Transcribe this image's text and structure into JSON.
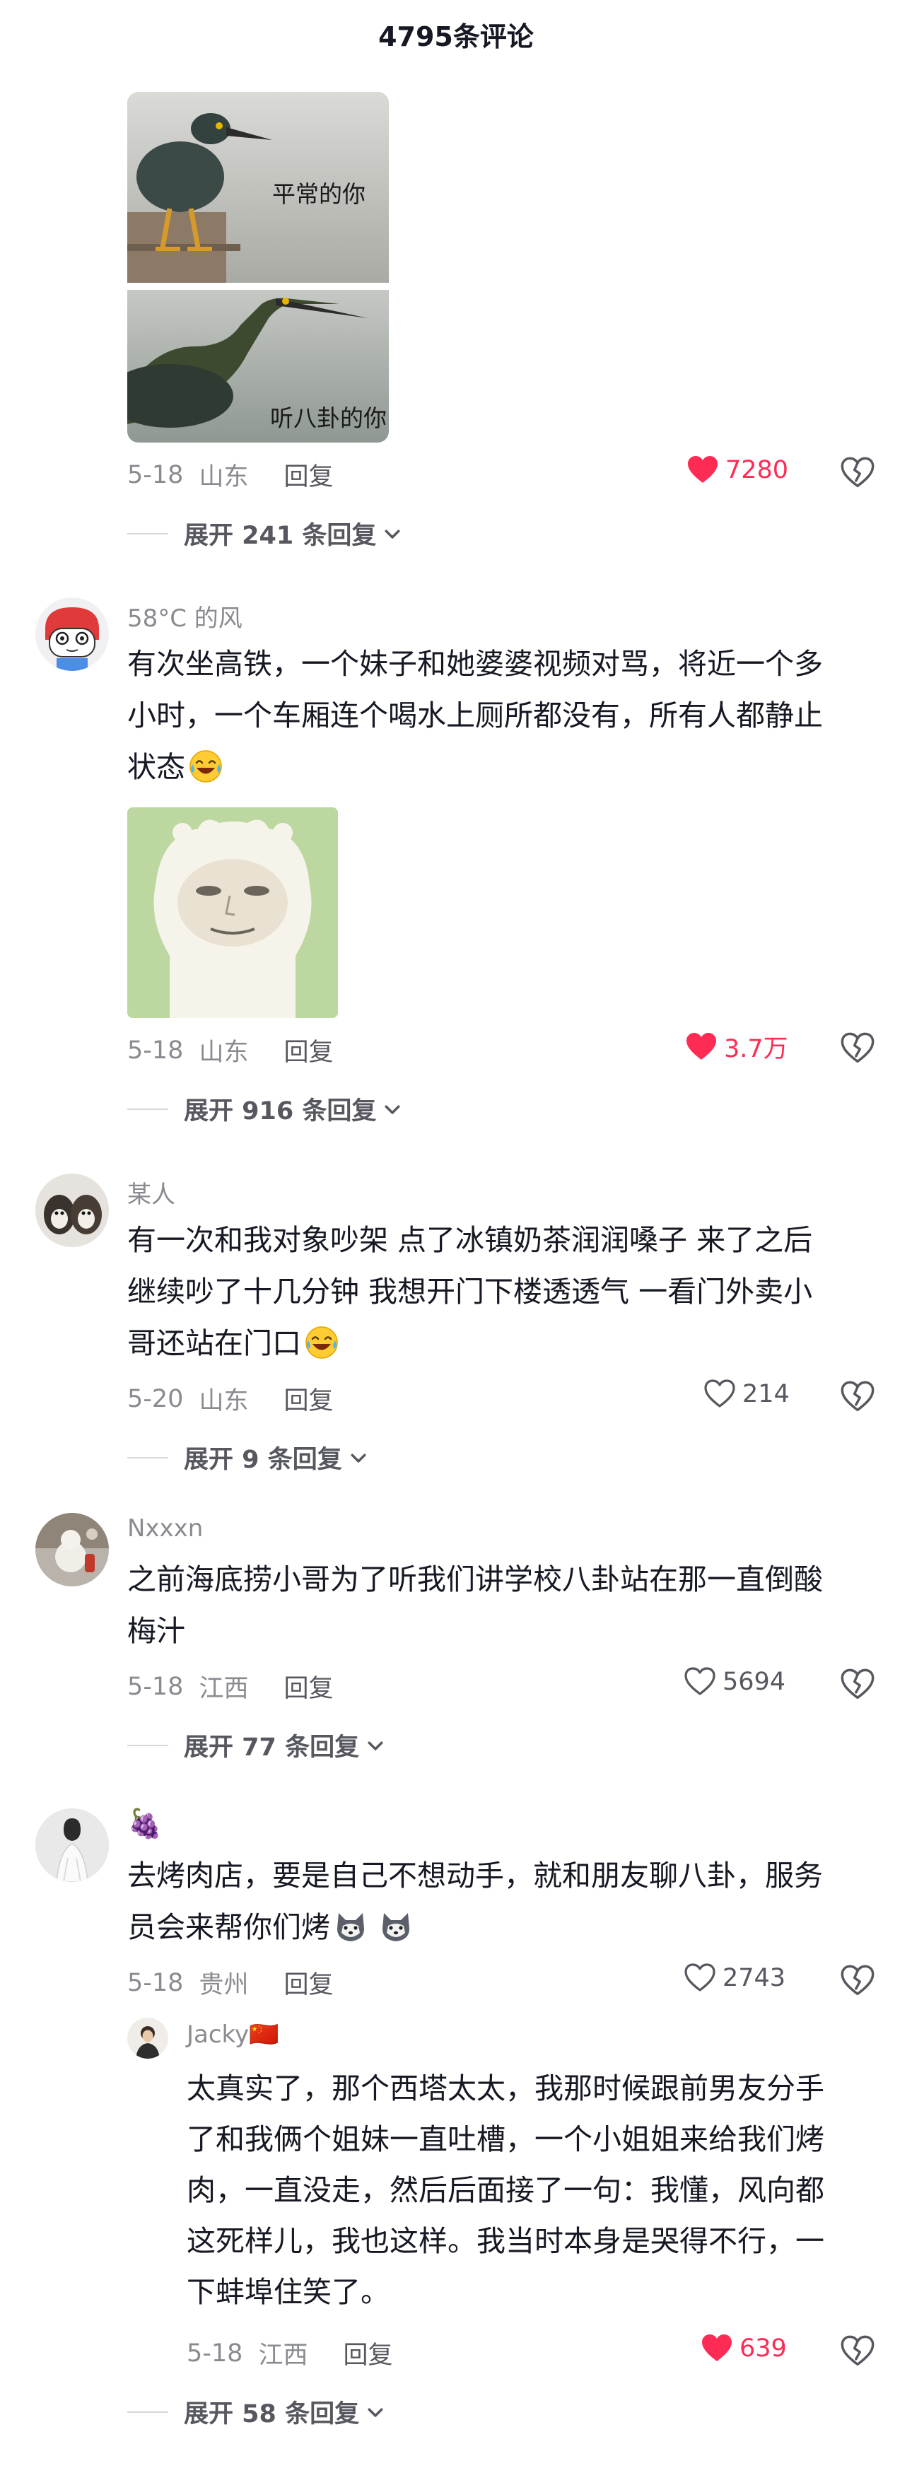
{
  "header": {
    "title": "4795条评论"
  },
  "comments": [
    {
      "image_caption_top": "平常的你",
      "image_caption_bottom": "听八卦的你",
      "date": "5-18",
      "location": "山东",
      "reply": "回复",
      "likes": "7280",
      "liked": true,
      "expand": "展开 241 条回复"
    },
    {
      "user": "58°C 的风",
      "text_lines": [
        "有次坐高铁，一个妹子和她婆婆视频对骂，将近一个多",
        "小时，一个车厢连个喝水上厕所都没有，所有人都静止",
        "状态"
      ],
      "date": "5-18",
      "location": "山东",
      "reply": "回复",
      "likes": "3.7万",
      "liked": true,
      "expand": "展开 916 条回复"
    },
    {
      "user": "某人",
      "text_lines": [
        "有一次和我对象吵架 点了冰镇奶茶润润嗓子 来了之后",
        "继续吵了十几分钟  我想开门下楼透透气 一看门外卖小",
        "哥还站在门口"
      ],
      "date": "5-20",
      "location": "山东",
      "reply": "回复",
      "likes": "214",
      "liked": false,
      "expand": "展开 9 条回复"
    },
    {
      "user": "Nxxxn",
      "text_lines": [
        "之前海底捞小哥为了听我们讲学校八卦站在那一直倒酸",
        "梅汁"
      ],
      "date": "5-18",
      "location": "江西",
      "reply": "回复",
      "likes": "5694",
      "liked": false,
      "expand": "展开 77 条回复"
    },
    {
      "user": "🍇",
      "text_lines": [
        "去烤肉店，要是自己不想动手，就和朋友聊八卦，服务",
        "员会来帮你们烤"
      ],
      "date": "5-18",
      "location": "贵州",
      "reply": "回复",
      "likes": "2743",
      "liked": false
    },
    {
      "user": "Jacky🇨🇳",
      "text_lines": [
        "太真实了，那个西塔太太，我那时候跟前男友分手",
        "了和我俩个姐妹一直吐槽，一个小姐姐来给我们烤",
        "肉，一直没走，然后后面接了一句：我懂，风向都",
        "这死样儿，我也这样。我当时本身是哭得不行，一",
        "下蚌埠住笑了。"
      ],
      "date": "5-18",
      "location": "江西",
      "reply": "回复",
      "likes": "639",
      "liked": true,
      "expand": "展开 58 条回复"
    }
  ],
  "colors": {
    "liked": "#fe2c55",
    "muted": "#8a8b91",
    "text": "#161823"
  }
}
